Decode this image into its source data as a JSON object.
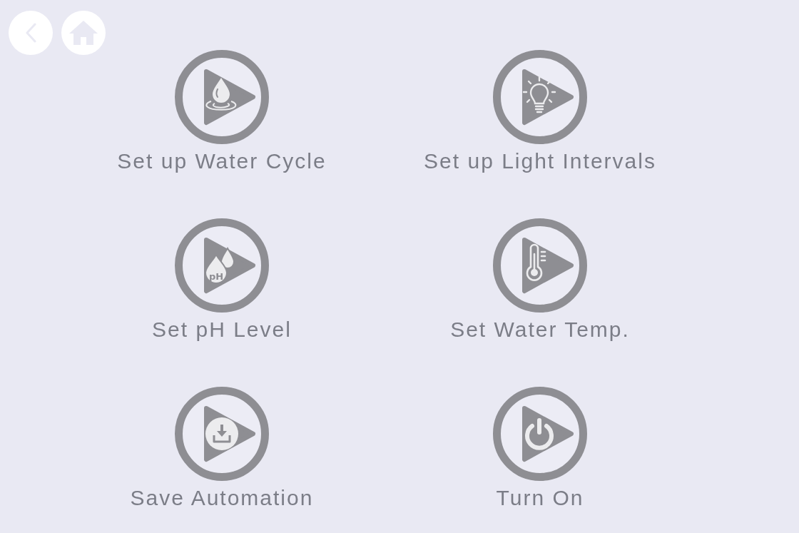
{
  "nav": [
    {
      "kind": "back"
    },
    {
      "kind": "home"
    }
  ],
  "actions": [
    {
      "kind": "water",
      "label": "Set up Water Cycle"
    },
    {
      "kind": "light",
      "label": "Set up Light Intervals"
    },
    {
      "kind": "ph",
      "label": "Set pH Level",
      "symbol": "pH"
    },
    {
      "kind": "temp",
      "label": "Set Water Temp."
    },
    {
      "kind": "save",
      "label": "Save Automation"
    },
    {
      "kind": "power",
      "label": "Turn On"
    }
  ]
}
